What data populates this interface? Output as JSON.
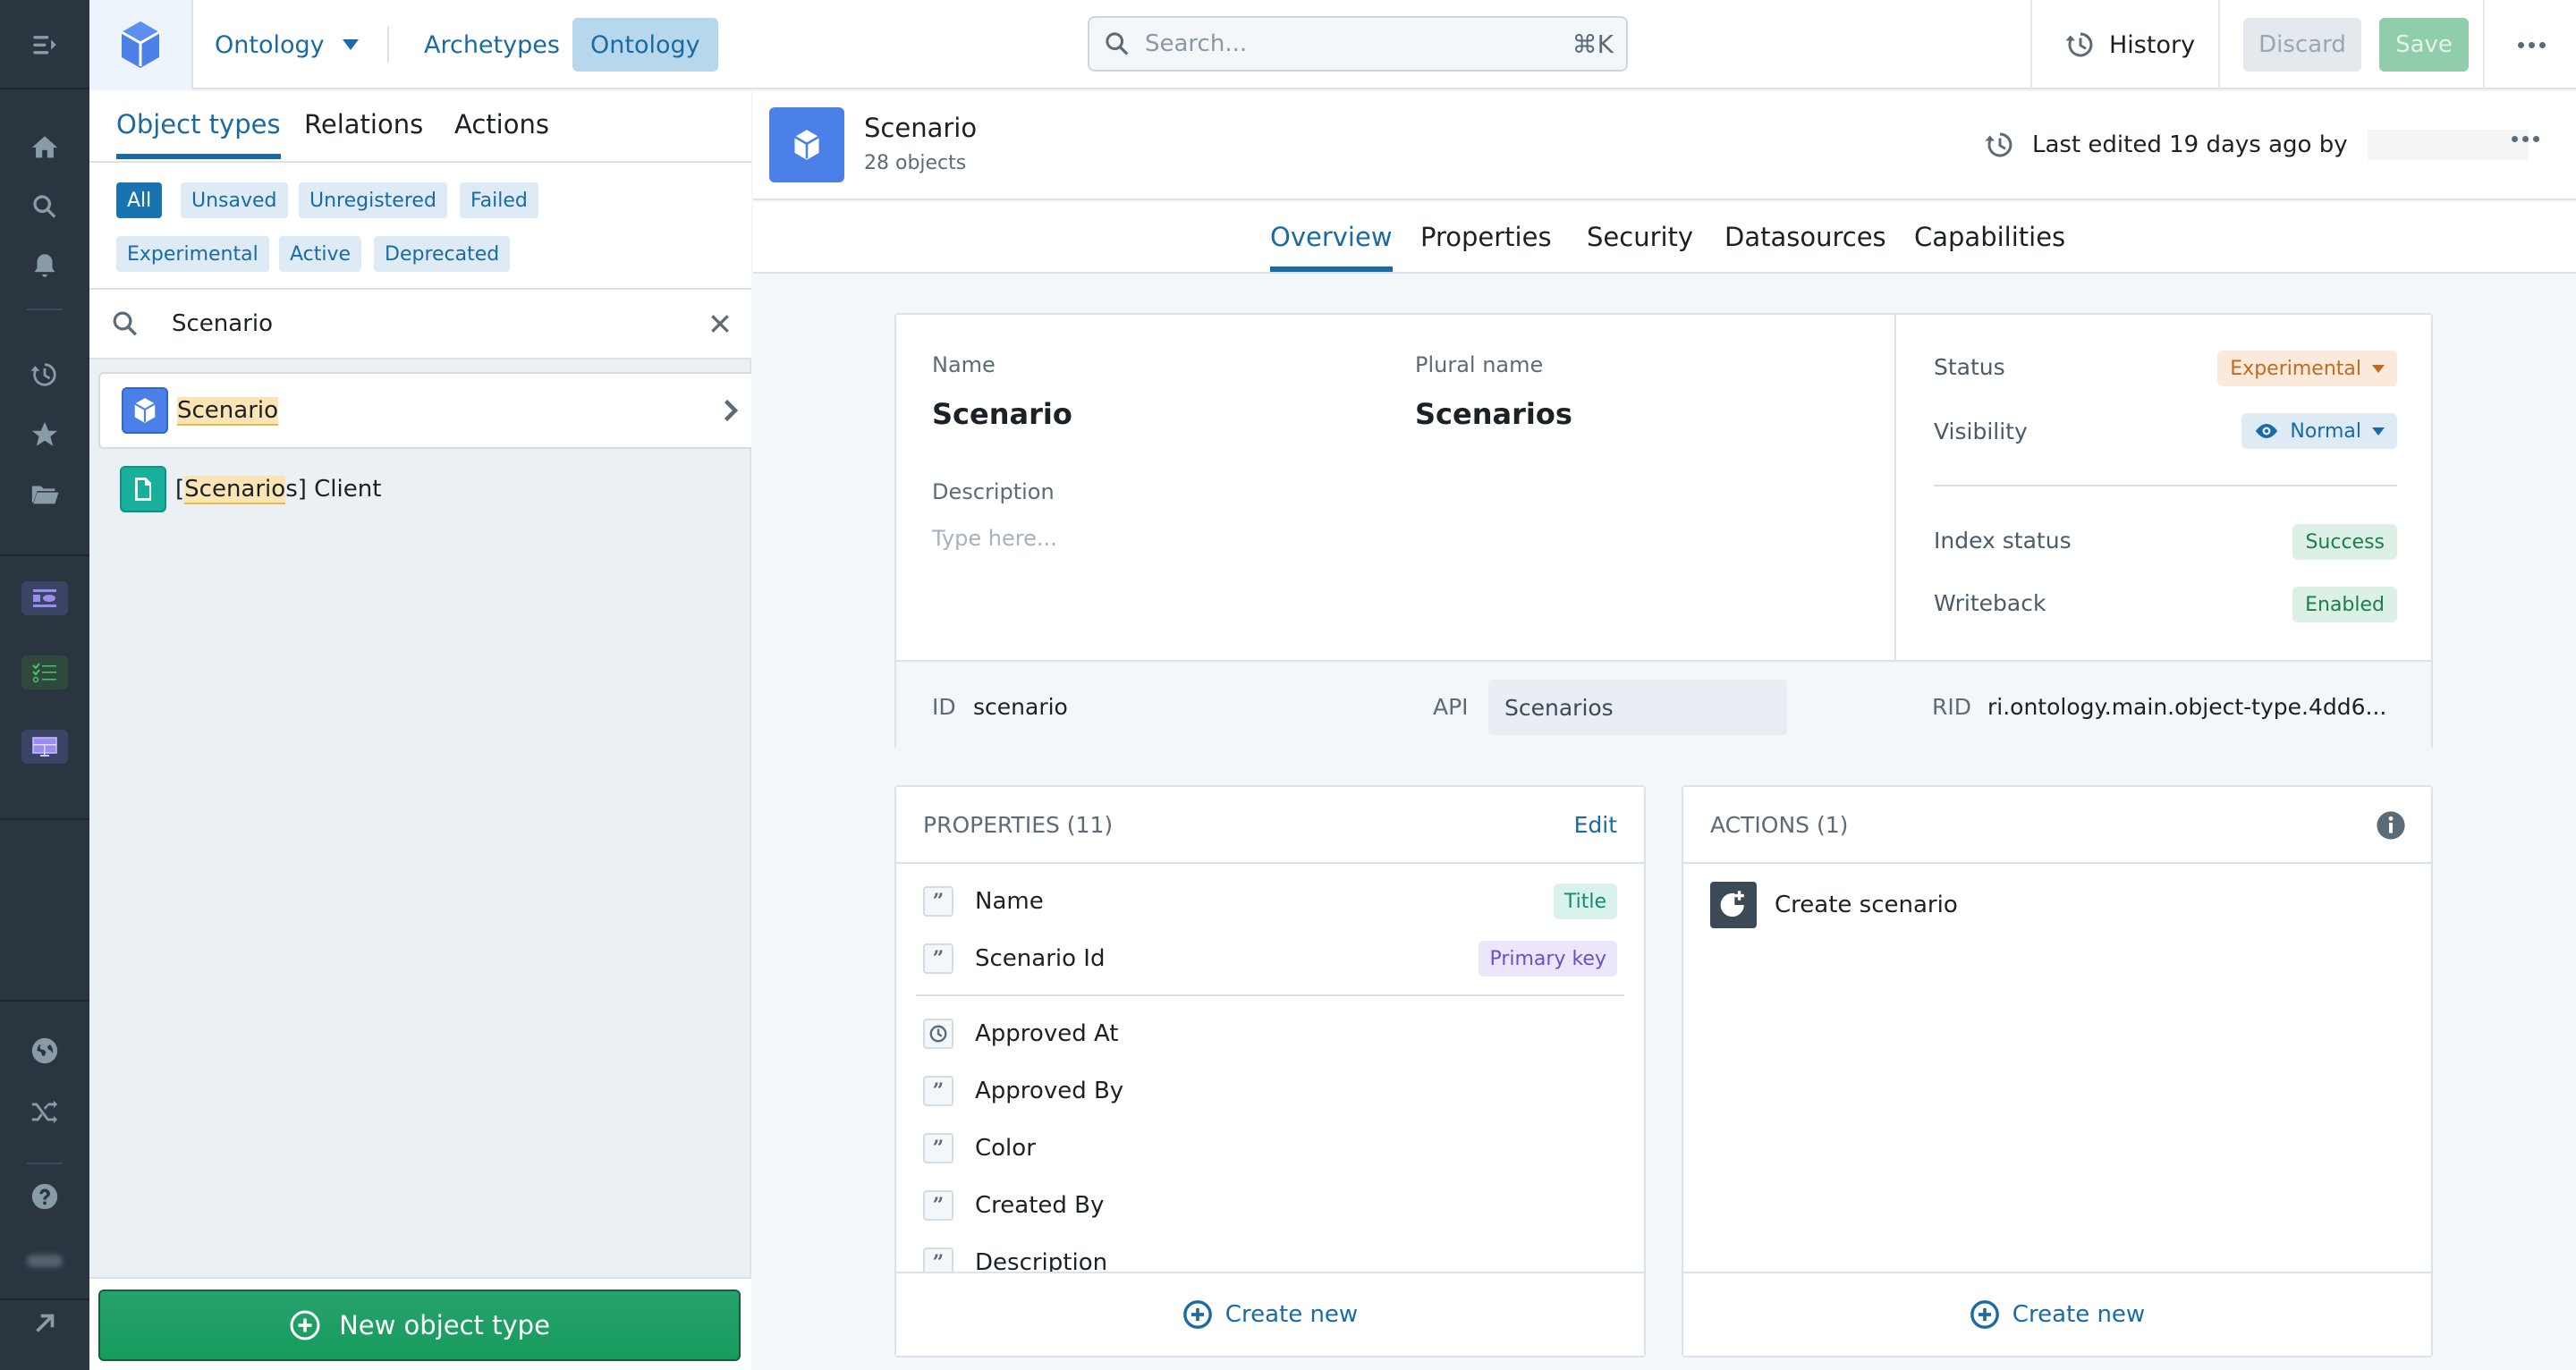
{
  "topbar": {
    "app_dropdown": "Ontology",
    "nav_links": [
      {
        "label": "Archetypes",
        "active": false
      },
      {
        "label": "Ontology",
        "active": true
      }
    ],
    "search_placeholder": "Search...",
    "search_shortcut": "⌘K",
    "history_label": "History",
    "discard_label": "Discard",
    "save_label": "Save"
  },
  "rail": {
    "icons": [
      "menu-expand-icon",
      "home-icon",
      "search-icon",
      "notifications-icon",
      "recent-icon",
      "favorites-icon",
      "folder-icon",
      "app-object-explorer-icon",
      "app-checklist-icon",
      "app-dashboard-icon",
      "globe-icon",
      "shuffle-icon",
      "help-icon",
      "avatar-icon",
      "external-link-icon"
    ]
  },
  "left_panel": {
    "tabs": [
      {
        "label": "Object types",
        "active": true
      },
      {
        "label": "Relations",
        "active": false
      },
      {
        "label": "Actions",
        "active": false
      }
    ],
    "filters": [
      {
        "label": "All",
        "active": true
      },
      {
        "label": "Unsaved",
        "active": false
      },
      {
        "label": "Unregistered",
        "active": false
      },
      {
        "label": "Failed",
        "active": false
      },
      {
        "label": "Experimental",
        "active": false
      },
      {
        "label": "Active",
        "active": false
      },
      {
        "label": "Deprecated",
        "active": false
      }
    ],
    "search_value": "Scenario",
    "results": [
      {
        "prefix": "",
        "highlight": "Scenario",
        "suffix": "",
        "icon": "cube-icon",
        "color": "#4a80e8",
        "selected": true
      },
      {
        "prefix": "[",
        "highlight": "Scenario",
        "suffix": "s] Client",
        "icon": "document-icon",
        "color": "#18b09b",
        "selected": false
      }
    ],
    "new_button_label": "New object type"
  },
  "header": {
    "title": "Scenario",
    "count": "28 objects",
    "last_edited": "Last edited 19 days ago by"
  },
  "main_tabs": [
    {
      "label": "Overview",
      "active": true
    },
    {
      "label": "Properties",
      "active": false
    },
    {
      "label": "Security",
      "active": false
    },
    {
      "label": "Datasources",
      "active": false
    },
    {
      "label": "Capabilities",
      "active": false
    }
  ],
  "overview": {
    "name_label": "Name",
    "name_value": "Scenario",
    "plural_label": "Plural name",
    "plural_value": "Scenarios",
    "description_label": "Description",
    "description_placeholder": "Type here...",
    "status_label": "Status",
    "status_value": "Experimental",
    "visibility_label": "Visibility",
    "visibility_value": "Normal",
    "index_label": "Index status",
    "index_value": "Success",
    "writeback_label": "Writeback",
    "writeback_value": "Enabled",
    "id_label": "ID",
    "id_value": "scenario",
    "api_label": "API",
    "api_value": "Scenarios",
    "rid_label": "RID",
    "rid_value": "ri.ontology.main.object-type.4dd6..."
  },
  "properties_card": {
    "title": "PROPERTIES (11)",
    "edit_label": "Edit",
    "items": [
      {
        "name": "Name",
        "type": "string",
        "tag": "Title"
      },
      {
        "name": "Scenario Id",
        "type": "string",
        "tag": "Primary key"
      },
      {
        "name": "Approved At",
        "type": "timestamp",
        "tag": ""
      },
      {
        "name": "Approved By",
        "type": "string",
        "tag": ""
      },
      {
        "name": "Color",
        "type": "string",
        "tag": ""
      },
      {
        "name": "Created By",
        "type": "string",
        "tag": ""
      },
      {
        "name": "Description",
        "type": "string",
        "tag": ""
      }
    ],
    "create_label": "Create new"
  },
  "actions_card": {
    "title": "ACTIONS (1)",
    "items": [
      {
        "name": "Create scenario"
      }
    ],
    "create_label": "Create new"
  },
  "colors": {
    "accent": "#1a6aa3",
    "primary_green": "#169b5e",
    "experimental": "#c26a1d",
    "success": "#1a7f4b",
    "primary_key": "#6b4fc8",
    "title_tag": "#138a76"
  }
}
